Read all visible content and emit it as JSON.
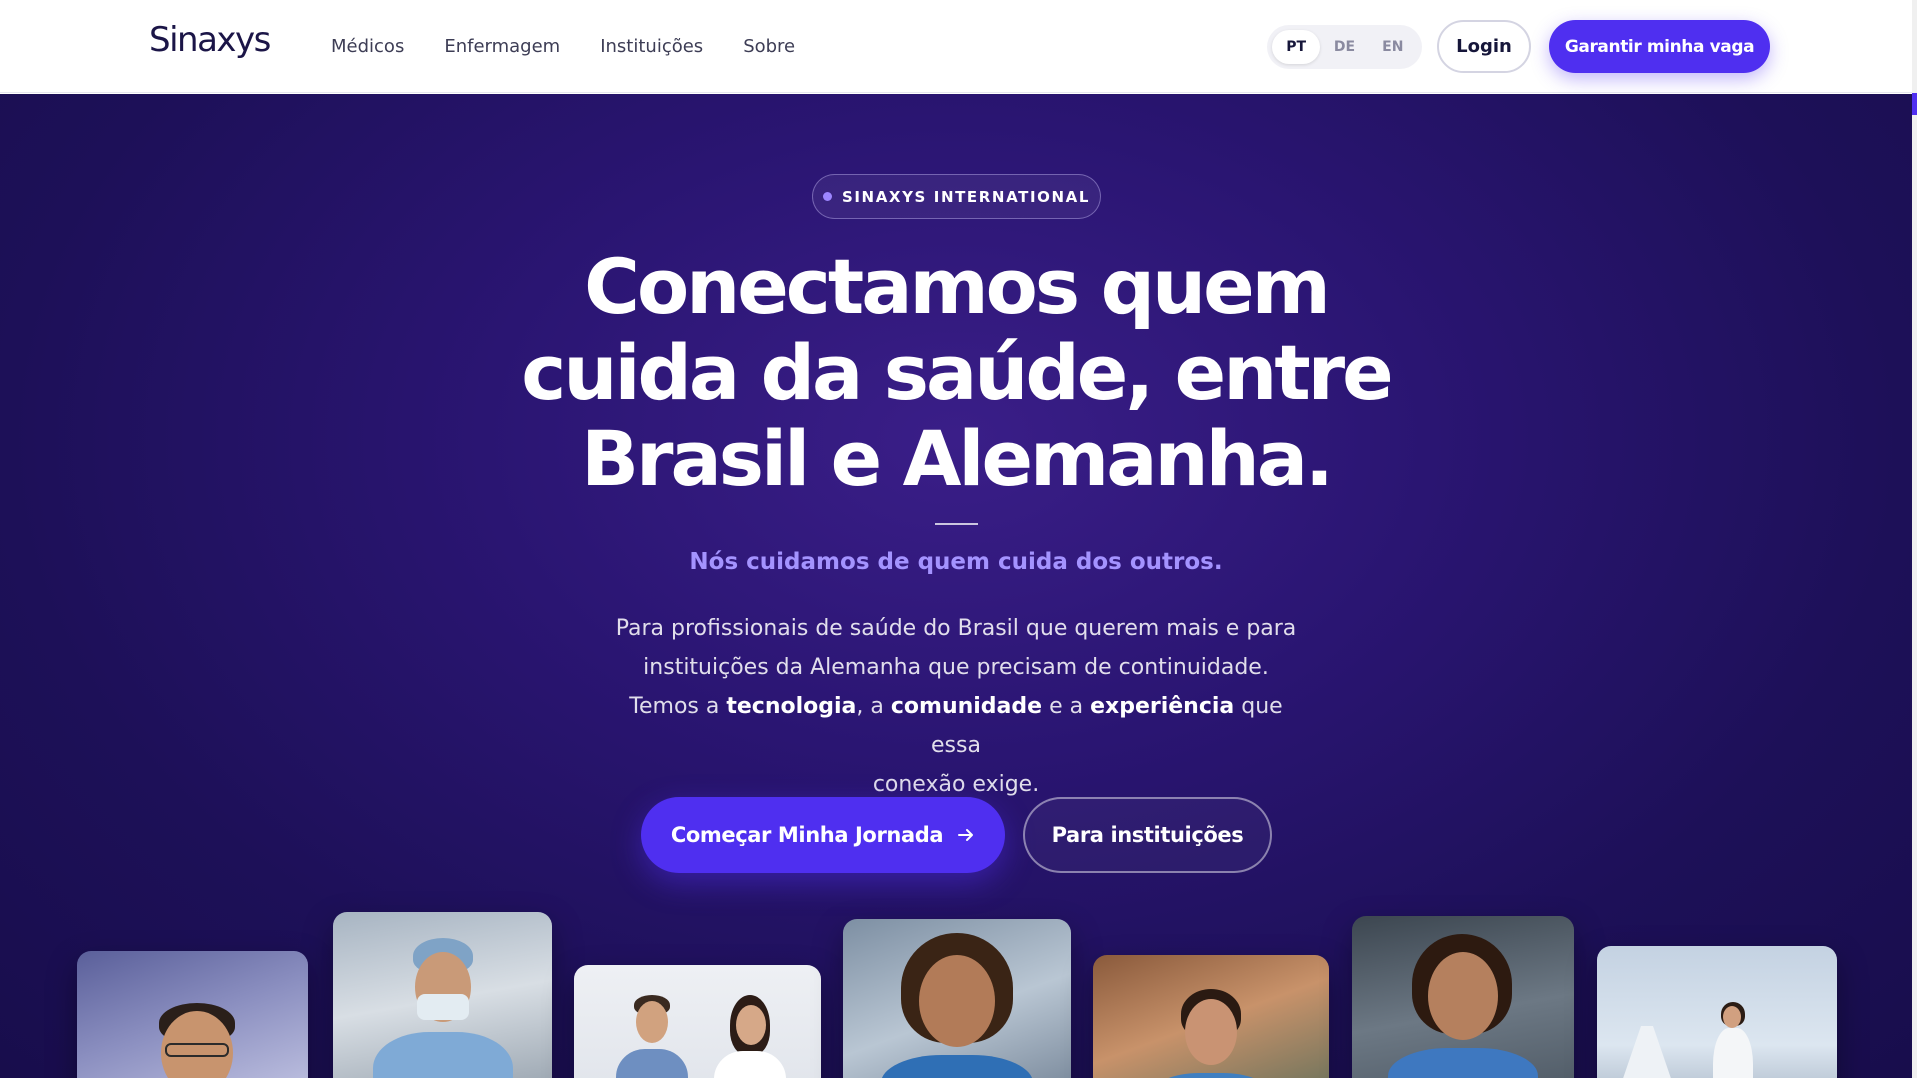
{
  "header": {
    "logo": "Sinaxys",
    "nav": [
      {
        "label": "Médicos"
      },
      {
        "label": "Enfermagem"
      },
      {
        "label": "Instituições"
      },
      {
        "label": "Sobre"
      }
    ],
    "languages": [
      {
        "code": "PT",
        "active": true
      },
      {
        "code": "DE",
        "active": false
      },
      {
        "code": "EN",
        "active": false
      }
    ],
    "login_label": "Login",
    "cta_label": "Garantir minha vaga"
  },
  "hero": {
    "badge": "SINAXYS INTERNATIONAL",
    "headline_lines": [
      "Conectamos quem",
      "cuida da saúde, entre",
      "Brasil e Alemanha."
    ],
    "tagline": "Nós cuidamos de quem cuida dos outros.",
    "description": {
      "line1": "Para profissionais de saúde do Brasil que querem mais e para",
      "line2": "instituições da Alemanha que precisam de continuidade.",
      "line3_a": "Temos a ",
      "line3_b": "tecnologia",
      "line3_c": ", a ",
      "line3_d": "comunidade",
      "line3_e": " e a ",
      "line3_f": "experiência",
      "line3_g": " que essa",
      "line4": "conexão exige."
    },
    "primary_button": "Começar Minha Jornada",
    "primary_button_icon": "arrow-right-icon",
    "secondary_button": "Para instituições"
  },
  "colors": {
    "accent": "#4f2ff0",
    "hero_bg": "#1d1058",
    "tagline": "#a493ff",
    "logo": "#1b1547"
  }
}
